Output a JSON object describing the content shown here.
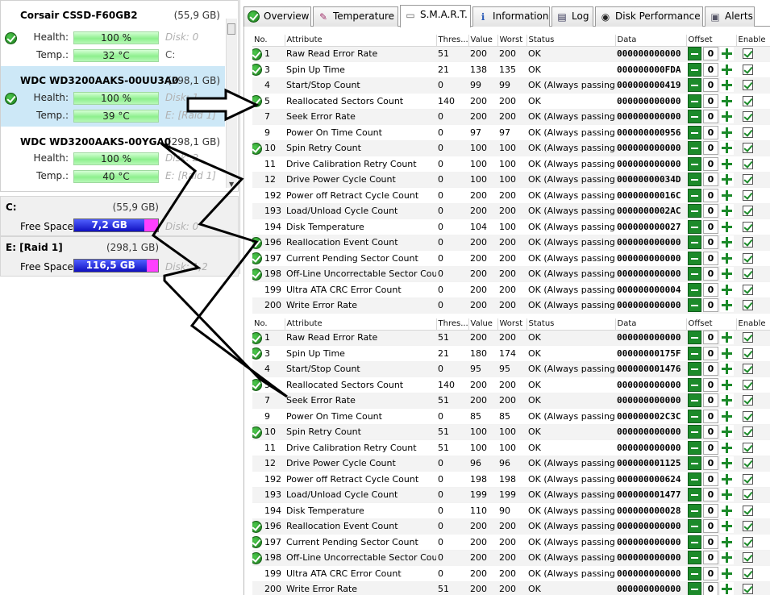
{
  "disks": [
    {
      "name": "Corsair CSSD-F60GB2",
      "size": "(55,9 GB)",
      "health_label": "Health:",
      "health": "100 %",
      "temp_label": "Temp.:",
      "temp": "32 °C",
      "disk_ghost": "Disk: 0",
      "vol_ghost": "C:",
      "selected": false
    },
    {
      "name": "WDC WD3200AAKS-00UU3A0",
      "size": "(298,1 GB)",
      "health_label": "Health:",
      "health": "100 %",
      "temp_label": "Temp.:",
      "temp": "39 °C",
      "disk_ghost": "Disk: 1",
      "vol_ghost": "E: [Raid 1]",
      "selected": true
    },
    {
      "name": "WDC WD3200AAKS-00YGA0",
      "size": "(298,1 GB)",
      "health_label": "Health:",
      "health": "100 %",
      "temp_label": "Temp.:",
      "temp": "40 °C",
      "disk_ghost": "Disk: 2",
      "vol_ghost": "E: [Raid 1]",
      "selected": false
    }
  ],
  "volumes": [
    {
      "name": "C:",
      "size": "(55,9 GB)",
      "free_label": "Free Space",
      "free": "7,2 GB",
      "free_fraction": 0.84,
      "disk_ghost": "Disk: 0"
    },
    {
      "name": "E: [Raid 1]",
      "size": "(298,1 GB)",
      "free_label": "Free Space",
      "free": "116,5 GB",
      "free_fraction": 0.87,
      "disk_ghost": "Disk: 1,2"
    }
  ],
  "tabs": [
    {
      "label": "Overview",
      "icon": "ok-icon"
    },
    {
      "label": "Temperature",
      "icon": "thermometer-icon"
    },
    {
      "label": "S.M.A.R.T.",
      "icon": "drive-icon"
    },
    {
      "label": "Information",
      "icon": "info-icon"
    },
    {
      "label": "Log",
      "icon": "log-icon"
    },
    {
      "label": "Disk Performance",
      "icon": "performance-icon"
    },
    {
      "label": "Alerts",
      "icon": "alerts-icon"
    }
  ],
  "active_tab": "S.M.A.R.T.",
  "columns": [
    "No.",
    "Attribute",
    "Thres...",
    "Value",
    "Worst",
    "Status",
    "Data",
    "Offset",
    "Enable"
  ],
  "tables": [
    {
      "rows": [
        {
          "no": "1",
          "attr": "Raw Read Error Rate",
          "thres": "51",
          "value": "200",
          "worst": "200",
          "status": "OK",
          "data": "000000000000",
          "offset": "0",
          "ok": true
        },
        {
          "no": "3",
          "attr": "Spin Up Time",
          "thres": "21",
          "value": "138",
          "worst": "135",
          "status": "OK",
          "data": "000000000FDA",
          "offset": "0",
          "ok": true
        },
        {
          "no": "4",
          "attr": "Start/Stop Count",
          "thres": "0",
          "value": "99",
          "worst": "99",
          "status": "OK (Always passing)",
          "data": "000000000419",
          "offset": "0",
          "ok": false
        },
        {
          "no": "5",
          "attr": "Reallocated Sectors Count",
          "thres": "140",
          "value": "200",
          "worst": "200",
          "status": "OK",
          "data": "000000000000",
          "offset": "0",
          "ok": true
        },
        {
          "no": "7",
          "attr": "Seek Error Rate",
          "thres": "0",
          "value": "200",
          "worst": "200",
          "status": "OK (Always passing)",
          "data": "000000000000",
          "offset": "0",
          "ok": false
        },
        {
          "no": "9",
          "attr": "Power On Time Count",
          "thres": "0",
          "value": "97",
          "worst": "97",
          "status": "OK (Always passing)",
          "data": "000000000956",
          "offset": "0",
          "ok": false
        },
        {
          "no": "10",
          "attr": "Spin Retry Count",
          "thres": "0",
          "value": "100",
          "worst": "100",
          "status": "OK (Always passing)",
          "data": "000000000000",
          "offset": "0",
          "ok": true
        },
        {
          "no": "11",
          "attr": "Drive Calibration Retry Count",
          "thres": "0",
          "value": "100",
          "worst": "100",
          "status": "OK (Always passing)",
          "data": "000000000000",
          "offset": "0",
          "ok": false
        },
        {
          "no": "12",
          "attr": "Drive Power Cycle Count",
          "thres": "0",
          "value": "100",
          "worst": "100",
          "status": "OK (Always passing)",
          "data": "00000000034D",
          "offset": "0",
          "ok": false
        },
        {
          "no": "192",
          "attr": "Power off Retract Cycle Count",
          "thres": "0",
          "value": "200",
          "worst": "200",
          "status": "OK (Always passing)",
          "data": "00000000016C",
          "offset": "0",
          "ok": false
        },
        {
          "no": "193",
          "attr": "Load/Unload Cycle Count",
          "thres": "0",
          "value": "200",
          "worst": "200",
          "status": "OK (Always passing)",
          "data": "0000000002AC",
          "offset": "0",
          "ok": false
        },
        {
          "no": "194",
          "attr": "Disk Temperature",
          "thres": "0",
          "value": "104",
          "worst": "100",
          "status": "OK (Always passing)",
          "data": "000000000027",
          "offset": "0",
          "ok": false
        },
        {
          "no": "196",
          "attr": "Reallocation Event Count",
          "thres": "0",
          "value": "200",
          "worst": "200",
          "status": "OK (Always passing)",
          "data": "000000000000",
          "offset": "0",
          "ok": true
        },
        {
          "no": "197",
          "attr": "Current Pending Sector Count",
          "thres": "0",
          "value": "200",
          "worst": "200",
          "status": "OK (Always passing)",
          "data": "000000000000",
          "offset": "0",
          "ok": true
        },
        {
          "no": "198",
          "attr": "Off-Line Uncorrectable Sector Count",
          "thres": "0",
          "value": "200",
          "worst": "200",
          "status": "OK (Always passing)",
          "data": "000000000000",
          "offset": "0",
          "ok": true
        },
        {
          "no": "199",
          "attr": "Ultra ATA CRC Error Count",
          "thres": "0",
          "value": "200",
          "worst": "200",
          "status": "OK (Always passing)",
          "data": "000000000004",
          "offset": "0",
          "ok": false
        },
        {
          "no": "200",
          "attr": "Write Error Rate",
          "thres": "0",
          "value": "200",
          "worst": "200",
          "status": "OK (Always passing)",
          "data": "000000000000",
          "offset": "0",
          "ok": false
        }
      ]
    },
    {
      "rows": [
        {
          "no": "1",
          "attr": "Raw Read Error Rate",
          "thres": "51",
          "value": "200",
          "worst": "200",
          "status": "OK",
          "data": "000000000000",
          "offset": "0",
          "ok": true
        },
        {
          "no": "3",
          "attr": "Spin Up Time",
          "thres": "21",
          "value": "180",
          "worst": "174",
          "status": "OK",
          "data": "00000000175F",
          "offset": "0",
          "ok": true
        },
        {
          "no": "4",
          "attr": "Start/Stop Count",
          "thres": "0",
          "value": "95",
          "worst": "95",
          "status": "OK (Always passing)",
          "data": "000000001476",
          "offset": "0",
          "ok": false
        },
        {
          "no": "5",
          "attr": "Reallocated Sectors Count",
          "thres": "140",
          "value": "200",
          "worst": "200",
          "status": "OK",
          "data": "000000000000",
          "offset": "0",
          "ok": true
        },
        {
          "no": "7",
          "attr": "Seek Error Rate",
          "thres": "51",
          "value": "200",
          "worst": "200",
          "status": "OK",
          "data": "000000000000",
          "offset": "0",
          "ok": false
        },
        {
          "no": "9",
          "attr": "Power On Time Count",
          "thres": "0",
          "value": "85",
          "worst": "85",
          "status": "OK (Always passing)",
          "data": "000000002C3C",
          "offset": "0",
          "ok": false
        },
        {
          "no": "10",
          "attr": "Spin Retry Count",
          "thres": "51",
          "value": "100",
          "worst": "100",
          "status": "OK",
          "data": "000000000000",
          "offset": "0",
          "ok": true
        },
        {
          "no": "11",
          "attr": "Drive Calibration Retry Count",
          "thres": "51",
          "value": "100",
          "worst": "100",
          "status": "OK",
          "data": "000000000000",
          "offset": "0",
          "ok": false
        },
        {
          "no": "12",
          "attr": "Drive Power Cycle Count",
          "thres": "0",
          "value": "96",
          "worst": "96",
          "status": "OK (Always passing)",
          "data": "000000001125",
          "offset": "0",
          "ok": false
        },
        {
          "no": "192",
          "attr": "Power off Retract Cycle Count",
          "thres": "0",
          "value": "198",
          "worst": "198",
          "status": "OK (Always passing)",
          "data": "000000000624",
          "offset": "0",
          "ok": false
        },
        {
          "no": "193",
          "attr": "Load/Unload Cycle Count",
          "thres": "0",
          "value": "199",
          "worst": "199",
          "status": "OK (Always passing)",
          "data": "000000001477",
          "offset": "0",
          "ok": false
        },
        {
          "no": "194",
          "attr": "Disk Temperature",
          "thres": "0",
          "value": "110",
          "worst": "90",
          "status": "OK (Always passing)",
          "data": "000000000028",
          "offset": "0",
          "ok": false
        },
        {
          "no": "196",
          "attr": "Reallocation Event Count",
          "thres": "0",
          "value": "200",
          "worst": "200",
          "status": "OK (Always passing)",
          "data": "000000000000",
          "offset": "0",
          "ok": true
        },
        {
          "no": "197",
          "attr": "Current Pending Sector Count",
          "thres": "0",
          "value": "200",
          "worst": "200",
          "status": "OK (Always passing)",
          "data": "000000000000",
          "offset": "0",
          "ok": true
        },
        {
          "no": "198",
          "attr": "Off-Line Uncorrectable Sector Count",
          "thres": "0",
          "value": "200",
          "worst": "200",
          "status": "OK (Always passing)",
          "data": "000000000000",
          "offset": "0",
          "ok": true
        },
        {
          "no": "199",
          "attr": "Ultra ATA CRC Error Count",
          "thres": "0",
          "value": "200",
          "worst": "200",
          "status": "OK (Always passing)",
          "data": "000000000000",
          "offset": "0",
          "ok": false
        },
        {
          "no": "200",
          "attr": "Write Error Rate",
          "thres": "51",
          "value": "200",
          "worst": "200",
          "status": "OK",
          "data": "000000000000",
          "offset": "0",
          "ok": false
        }
      ]
    }
  ],
  "colors": {
    "ok_green": "#1d7a1d",
    "selected_bg": "#cde8f7",
    "free_bar": "#1010c0",
    "used_bar": "#ff40ff"
  }
}
